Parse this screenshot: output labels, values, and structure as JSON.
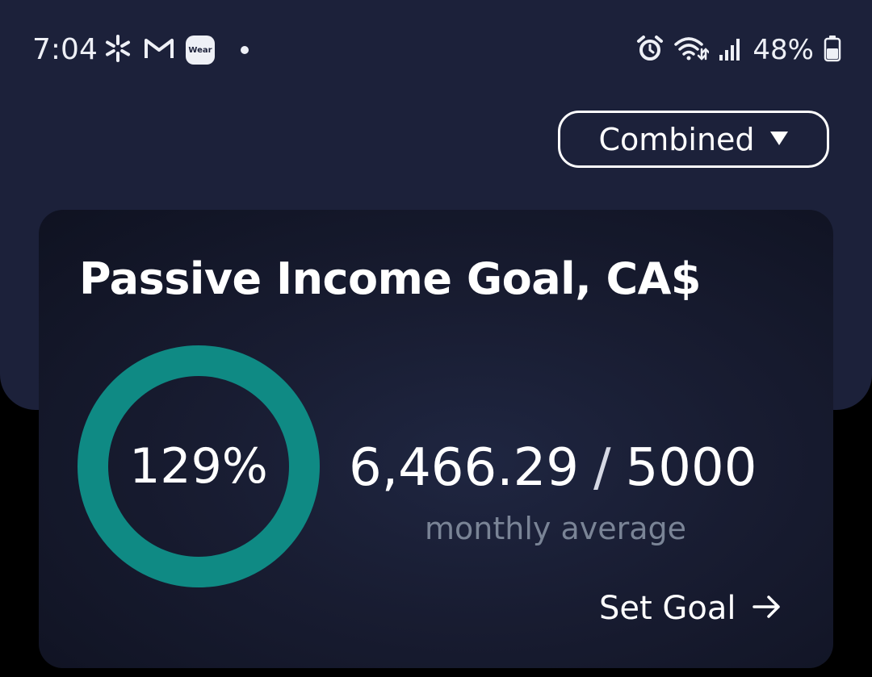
{
  "status_bar": {
    "time": "7:04",
    "left_icons": [
      "walmart-spark-icon",
      "gmail-icon",
      "wear-icon",
      "notification-dot-icon"
    ],
    "wear_badge_text": "Wear",
    "right_icons": [
      "alarm-icon",
      "wifi-icon",
      "signal-icon",
      "battery-icon"
    ],
    "battery_percent": "48%"
  },
  "filter": {
    "label": "Combined",
    "caret": "▼"
  },
  "goal_card": {
    "title": "Passive Income Goal, CA$",
    "progress_label": "129%",
    "progress_fraction": 1.29,
    "current_value": "6,466.29",
    "separator": "/",
    "goal_value": "5000",
    "sublabel": "monthly average",
    "set_goal_label": "Set Goal",
    "ring_color": "#0f8a84"
  },
  "colors": {
    "header_bg": "#1c213a",
    "page_bg": "#000000",
    "accent": "#0f8a84",
    "muted_text": "#7a8496"
  }
}
